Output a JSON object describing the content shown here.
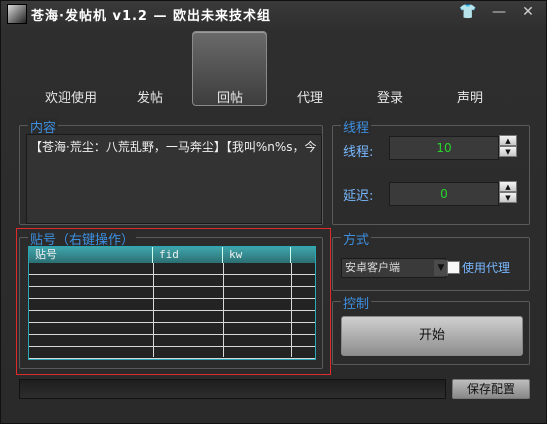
{
  "window": {
    "title": "苍海·发帖机 v1.2 — 欧出未来技术组",
    "buttons": {
      "skin": "👕",
      "minimize": "—",
      "close": "✕"
    }
  },
  "nav": {
    "items": [
      "欢迎使用",
      "发帖",
      "回帖",
      "代理",
      "登录",
      "声明"
    ],
    "selected": "回帖"
  },
  "content": {
    "label": "内容",
    "text": "【苍海·荒尘：八荒乱野，一马奔尘】【我叫%n%s，今"
  },
  "thread": {
    "label": "线程",
    "thread_label": "线程:",
    "thread_value": "10",
    "delay_label": "延迟:",
    "delay_value": "0"
  },
  "accounts": {
    "label": "贴号（右键操作）",
    "headers": [
      "贴号",
      "fid",
      "kw",
      ""
    ],
    "rows": [
      "",
      "",
      "",
      "",
      "",
      "",
      "",
      "",
      "",
      ""
    ]
  },
  "mode": {
    "label": "方式",
    "selected": "安卓客户端",
    "proxy_label": "使用代理"
  },
  "control": {
    "label": "控制",
    "start_label": "开始"
  },
  "footer": {
    "save_label": "保存配置"
  }
}
